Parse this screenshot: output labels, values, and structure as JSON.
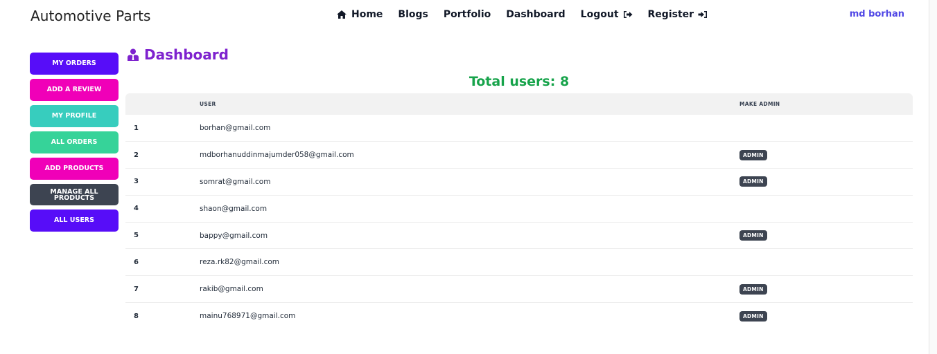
{
  "brand": "Automotive Parts",
  "nav": {
    "home": "Home",
    "blogs": "Blogs",
    "portfolio": "Portfolio",
    "dashboard": "Dashboard",
    "logout": "Logout",
    "register": "Register",
    "user": "md borhan"
  },
  "sidebar": [
    {
      "label": "My Orders",
      "color": "#570df8"
    },
    {
      "label": "Add a Review",
      "color": "#f000b8"
    },
    {
      "label": "My Profile",
      "color": "#37cdbe"
    },
    {
      "label": "All Orders",
      "color": "#36d399"
    },
    {
      "label": "Add Products",
      "color": "#f000b8"
    },
    {
      "label": "Manage All Products",
      "color": "#3d4451"
    },
    {
      "label": "All Users",
      "color": "#570df8"
    }
  ],
  "main": {
    "title": "Dashboard",
    "total": "Total users: 8",
    "columns": [
      "",
      "User",
      "Make Admin"
    ],
    "rows": [
      {
        "idx": "1",
        "email": "borhan@gmail.com",
        "admin": ""
      },
      {
        "idx": "2",
        "email": "mdborhanuddinmajumder058@gmail.com",
        "admin": "Admin"
      },
      {
        "idx": "3",
        "email": "somrat@gmail.com",
        "admin": "Admin"
      },
      {
        "idx": "4",
        "email": "shaon@gmail.com",
        "admin": ""
      },
      {
        "idx": "5",
        "email": "bappy@gmail.com",
        "admin": "Admin"
      },
      {
        "idx": "6",
        "email": "reza.rk82@gmail.com",
        "admin": ""
      },
      {
        "idx": "7",
        "email": "rakib@gmail.com",
        "admin": "Admin"
      },
      {
        "idx": "8",
        "email": "mainu768971@gmail.com",
        "admin": "Admin"
      }
    ]
  },
  "colors": {
    "accent": "#7e22ce",
    "total": "#16a34a",
    "user": "#4f46e5",
    "badge": "#3d4451"
  },
  "icons": [
    "home-icon",
    "logout-icon",
    "register-icon",
    "user-icon"
  ]
}
